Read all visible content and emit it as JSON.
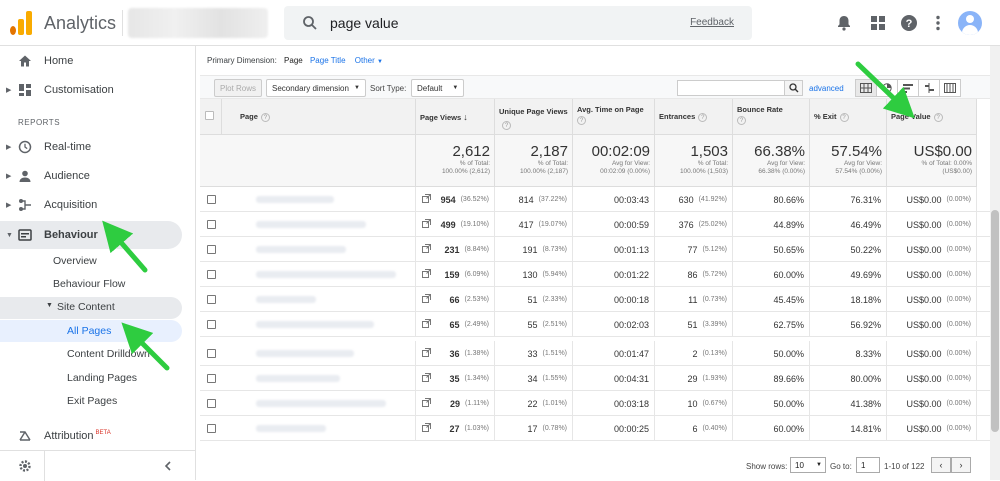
{
  "app": {
    "title": "Analytics",
    "search_value": "page value",
    "feedback_label": "Feedback",
    "accent": "#1a73e8",
    "logo_colors": [
      "#e37400",
      "#f9ab00"
    ]
  },
  "sidebar": {
    "top_items": [
      {
        "label": "Home",
        "icon": "home-icon"
      },
      {
        "label": "Customisation",
        "icon": "dashboard-icon"
      }
    ],
    "section_label": "REPORTS",
    "report_items": [
      {
        "label": "Real-time",
        "icon": "clock-icon"
      },
      {
        "label": "Audience",
        "icon": "person-icon"
      },
      {
        "label": "Acquisition",
        "icon": "acquisition-icon"
      },
      {
        "label": "Behaviour",
        "icon": "behaviour-icon"
      }
    ],
    "behaviour_sub": [
      {
        "label": "Overview"
      },
      {
        "label": "Behaviour Flow"
      }
    ],
    "site_content_label": "Site Content",
    "site_content_sub": [
      {
        "label": "All Pages"
      },
      {
        "label": "Content Drilldown"
      },
      {
        "label": "Landing Pages"
      },
      {
        "label": "Exit Pages"
      }
    ],
    "attribution_label": "Attribution",
    "attribution_badge": "BETA"
  },
  "report": {
    "primary_dim_label": "Primary Dimension:",
    "primary_dim_current": "Page",
    "primary_dim_options": [
      "Page Title",
      "Other"
    ],
    "plot_rows_label": "Plot Rows",
    "secondary_dim_label": "Secondary dimension",
    "sort_type_label": "Sort Type:",
    "sort_type_value": "Default",
    "advanced_label": "advanced",
    "columns": {
      "page": "Page",
      "page_views": "Page Views",
      "unique_page_views": "Unique Page Views",
      "avg_time": "Avg. Time on Page",
      "entrances": "Entrances",
      "bounce_rate": "Bounce Rate",
      "pct_exit": "% Exit",
      "page_value": "Page Value"
    },
    "totals": {
      "page_views": {
        "big": "2,612",
        "l1": "% of Total:",
        "l2": "100.00% (2,612)"
      },
      "unique_page_views": {
        "big": "2,187",
        "l1": "% of Total:",
        "l2": "100.00% (2,187)"
      },
      "avg_time": {
        "big": "00:02:09",
        "l1": "Avg for View:",
        "l2": "00:02:09 (0.00%)"
      },
      "entrances": {
        "big": "1,503",
        "l1": "% of Total:",
        "l2": "100.00% (1,503)"
      },
      "bounce_rate": {
        "big": "66.38%",
        "l1": "Avg for View:",
        "l2": "66.38% (0.00%)"
      },
      "pct_exit": {
        "big": "57.54%",
        "l1": "Avg for View:",
        "l2": "57.54% (0.00%)"
      },
      "page_value": {
        "big": "US$0.00",
        "l1": "% of Total: 0.00%",
        "l2": "(US$0.00)"
      }
    },
    "rows": [
      {
        "pv": "954",
        "pvp": "(36.52%)",
        "upv": "814",
        "upvp": "(37.22%)",
        "time": "00:03:43",
        "ent": "630",
        "entp": "(41.92%)",
        "br": "80.66%",
        "ex": "76.31%",
        "val": "US$0.00",
        "valp": "(0.00%)"
      },
      {
        "pv": "499",
        "pvp": "(19.10%)",
        "upv": "417",
        "upvp": "(19.07%)",
        "time": "00:00:59",
        "ent": "376",
        "entp": "(25.02%)",
        "br": "44.89%",
        "ex": "46.49%",
        "val": "US$0.00",
        "valp": "(0.00%)"
      },
      {
        "pv": "231",
        "pvp": "(8.84%)",
        "upv": "191",
        "upvp": "(8.73%)",
        "time": "00:01:13",
        "ent": "77",
        "entp": "(5.12%)",
        "br": "50.65%",
        "ex": "50.22%",
        "val": "US$0.00",
        "valp": "(0.00%)"
      },
      {
        "pv": "159",
        "pvp": "(6.09%)",
        "upv": "130",
        "upvp": "(5.94%)",
        "time": "00:01:22",
        "ent": "86",
        "entp": "(5.72%)",
        "br": "60.00%",
        "ex": "49.69%",
        "val": "US$0.00",
        "valp": "(0.00%)"
      },
      {
        "pv": "66",
        "pvp": "(2.53%)",
        "upv": "51",
        "upvp": "(2.33%)",
        "time": "00:00:18",
        "ent": "11",
        "entp": "(0.73%)",
        "br": "45.45%",
        "ex": "18.18%",
        "val": "US$0.00",
        "valp": "(0.00%)"
      },
      {
        "pv": "65",
        "pvp": "(2.49%)",
        "upv": "55",
        "upvp": "(2.51%)",
        "time": "00:02:03",
        "ent": "51",
        "entp": "(3.39%)",
        "br": "62.75%",
        "ex": "56.92%",
        "val": "US$0.00",
        "valp": "(0.00%)"
      },
      {
        "pv": "36",
        "pvp": "(1.38%)",
        "upv": "33",
        "upvp": "(1.51%)",
        "time": "00:01:47",
        "ent": "2",
        "entp": "(0.13%)",
        "br": "50.00%",
        "ex": "8.33%",
        "val": "US$0.00",
        "valp": "(0.00%)"
      },
      {
        "pv": "35",
        "pvp": "(1.34%)",
        "upv": "34",
        "upvp": "(1.55%)",
        "time": "00:04:31",
        "ent": "29",
        "entp": "(1.93%)",
        "br": "89.66%",
        "ex": "80.00%",
        "val": "US$0.00",
        "valp": "(0.00%)"
      },
      {
        "pv": "29",
        "pvp": "(1.11%)",
        "upv": "22",
        "upvp": "(1.01%)",
        "time": "00:03:18",
        "ent": "10",
        "entp": "(0.67%)",
        "br": "50.00%",
        "ex": "41.38%",
        "val": "US$0.00",
        "valp": "(0.00%)"
      },
      {
        "pv": "27",
        "pvp": "(1.03%)",
        "upv": "17",
        "upvp": "(0.78%)",
        "time": "00:00:25",
        "ent": "6",
        "entp": "(0.40%)",
        "br": "60.00%",
        "ex": "14.81%",
        "val": "US$0.00",
        "valp": "(0.00%)"
      }
    ],
    "footer": {
      "show_rows_label": "Show rows:",
      "show_rows_value": "10",
      "goto_label": "Go to:",
      "goto_value": "1",
      "range_label": "1-10 of 122"
    }
  },
  "annotation_color": "#2ecc40"
}
